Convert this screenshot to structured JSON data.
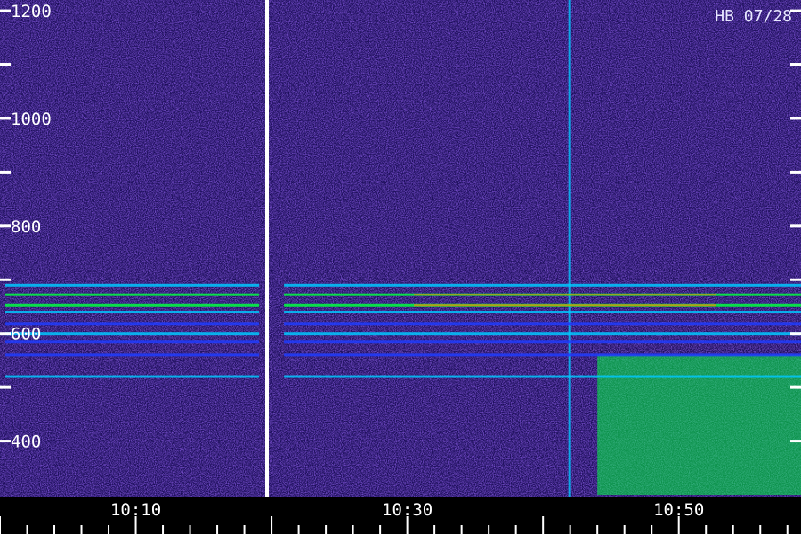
{
  "chart_data": {
    "type": "heatmap",
    "title": "",
    "xlabel": "",
    "ylabel": "",
    "stamp": "HB 07/28",
    "x_tick_labels": [
      "10:10",
      "10:30",
      "10:50"
    ],
    "y_tick_labels": [
      "1200",
      "1000",
      "800",
      "600",
      "400"
    ],
    "y_tick_values": [
      1200,
      1000,
      800,
      600,
      400
    ],
    "x_range": [
      "10:00",
      "10:59"
    ],
    "y_range": [
      300,
      1220
    ],
    "colors": {
      "background": "#000000",
      "noise": "#2a1a8c",
      "low": "#1e3cff",
      "mid": "#00c8ff",
      "high": "#00ff40",
      "peak": "#ff8000"
    },
    "horizontal_bands": [
      {
        "freq": 690,
        "intensity": 0.85
      },
      {
        "freq": 672,
        "intensity": 0.9
      },
      {
        "freq": 652,
        "intensity": 0.95
      },
      {
        "freq": 640,
        "intensity": 0.75
      },
      {
        "freq": 618,
        "intensity": 0.55
      },
      {
        "freq": 600,
        "intensity": 0.6
      },
      {
        "freq": 585,
        "intensity": 0.45
      },
      {
        "freq": 560,
        "intensity": 0.35
      },
      {
        "freq": 520,
        "intensity": 0.6
      }
    ],
    "gap_column_time": "10:20"
  }
}
